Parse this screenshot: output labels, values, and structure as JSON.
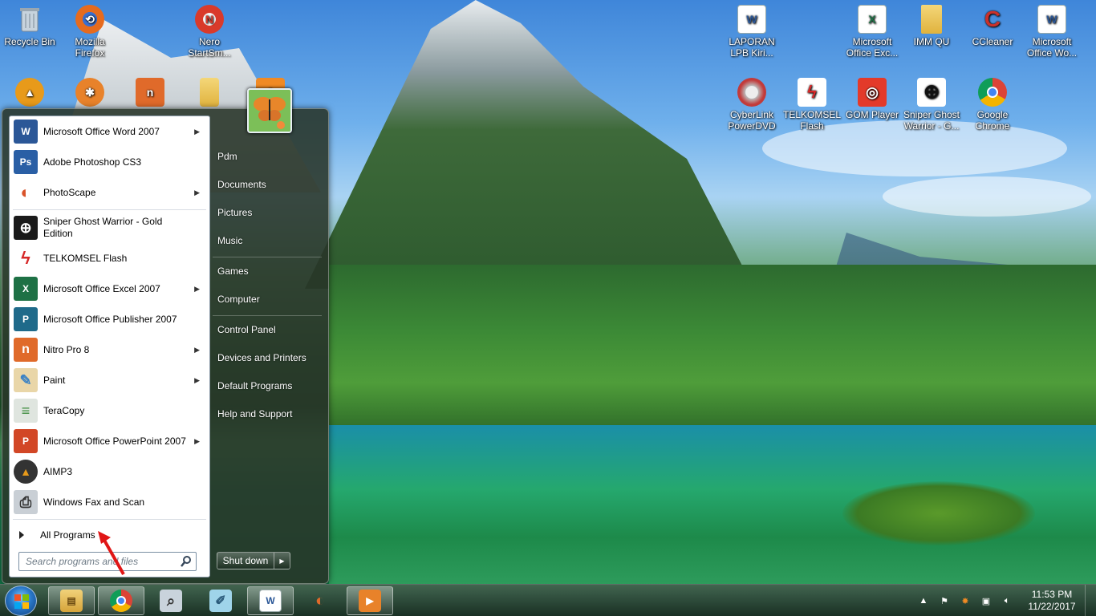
{
  "desktop": {
    "icons": [
      {
        "label": "Recycle Bin",
        "icon": "recycle-bin-icon",
        "color": "#a9b8c6"
      },
      {
        "label": "Mozilla Firefox",
        "icon": "firefox-icon",
        "color": "#e66b1e"
      },
      {
        "label": "Nero StartSm...",
        "icon": "nero-icon",
        "color": "#d93a2a"
      },
      {
        "label": "LAPORAN LPB Kiri...",
        "icon": "word-doc-icon",
        "color": "#2b5797"
      },
      {
        "label": "Microsoft Office Exc...",
        "icon": "excel-icon",
        "color": "#1e7145"
      },
      {
        "label": "IMM QU",
        "icon": "folder-icon",
        "color": "#e8c15a"
      },
      {
        "label": "CCleaner",
        "icon": "ccleaner-icon",
        "color": "#c8312b"
      },
      {
        "label": "Microsoft Office Wo...",
        "icon": "word-icon",
        "color": "#2b5797"
      },
      {
        "label": "CyberLink PowerDVD",
        "icon": "powerdvd-icon",
        "color": "#c23b3b"
      },
      {
        "label": "TELKOMSEL Flash",
        "icon": "telkomsel-icon",
        "color": "#d62828"
      },
      {
        "label": "GOM Player",
        "icon": "gom-player-icon",
        "color": "#e33a2a"
      },
      {
        "label": "Sniper Ghost Warrior - G...",
        "icon": "crosshair-icon",
        "color": "#222222"
      },
      {
        "label": "Google Chrome",
        "icon": "chrome-icon",
        "color": "#3a8f3a"
      }
    ],
    "partial_icons": [
      {
        "icon": "aimp-icon",
        "color": "#e89a1a"
      },
      {
        "icon": "ship-wheel-icon",
        "color": "#e8822a"
      },
      {
        "icon": "nitro-icon",
        "color": "#e06a2a"
      },
      {
        "icon": "folder-icon",
        "color": "#e8c15a"
      },
      {
        "icon": "photoscape-icon",
        "color": "#f08a24"
      }
    ]
  },
  "start_menu": {
    "programs": [
      {
        "label": "Microsoft Office Word 2007",
        "icon": "word-icon",
        "glyph": "W",
        "color": "#2b5797",
        "submenu": true
      },
      {
        "label": "Adobe Photoshop CS3",
        "icon": "photoshop-icon",
        "glyph": "Ps",
        "color": "#2a5fa5",
        "submenu": false
      },
      {
        "label": "PhotoScape",
        "icon": "photoscape-icon",
        "glyph": "◐",
        "color": "#6e7377",
        "submenu": true
      },
      {
        "label": "Sniper Ghost Warrior - Gold Edition",
        "icon": "crosshair-icon",
        "glyph": "⊕",
        "color": "#1a1a1a",
        "submenu": false
      },
      {
        "label": "TELKOMSEL Flash",
        "icon": "telkomsel-icon",
        "glyph": "ϟ",
        "color": "#d62828",
        "submenu": false
      },
      {
        "label": "Microsoft Office Excel 2007",
        "icon": "excel-icon",
        "glyph": "X",
        "color": "#1e7145",
        "submenu": true
      },
      {
        "label": "Microsoft Office Publisher 2007",
        "icon": "publisher-icon",
        "glyph": "P",
        "color": "#1f6a8a",
        "submenu": false
      },
      {
        "label": "Nitro Pro 8",
        "icon": "nitro-icon",
        "glyph": "n",
        "color": "#e06a2a",
        "submenu": true
      },
      {
        "label": "Paint",
        "icon": "paint-icon",
        "glyph": "✎",
        "color": "#3b82c4",
        "submenu": true
      },
      {
        "label": "TeraCopy",
        "icon": "teracopy-icon",
        "glyph": "≡",
        "color": "#6a8a6a",
        "submenu": false
      },
      {
        "label": "Microsoft Office PowerPoint 2007",
        "icon": "powerpoint-icon",
        "glyph": "P",
        "color": "#d24726",
        "submenu": true
      },
      {
        "label": "AIMP3",
        "icon": "aimp-icon",
        "glyph": "▲",
        "color": "#e89a1a",
        "submenu": false
      },
      {
        "label": "Windows Fax and Scan",
        "icon": "fax-scan-icon",
        "glyph": "⎙",
        "color": "#707a84",
        "submenu": false
      }
    ],
    "all_programs": "All Programs",
    "search_placeholder": "Search programs and files",
    "right_items": [
      {
        "label": "Pdm",
        "name": "user-folder-link"
      },
      {
        "label": "Documents",
        "name": "documents-link"
      },
      {
        "label": "Pictures",
        "name": "pictures-link"
      },
      {
        "label": "Music",
        "name": "music-link"
      },
      {
        "label": "Games",
        "name": "games-link"
      },
      {
        "label": "Computer",
        "name": "computer-link"
      },
      {
        "label": "Control Panel",
        "name": "control-panel-link"
      },
      {
        "label": "Devices and Printers",
        "name": "devices-printers-link"
      },
      {
        "label": "Default Programs",
        "name": "default-programs-link"
      },
      {
        "label": "Help and Support",
        "name": "help-support-link"
      }
    ],
    "shutdown_label": "Shut down"
  },
  "taskbar": {
    "apps": [
      {
        "icon": "windows-explorer-icon",
        "glyph": "▤",
        "color": "#e3b44a",
        "active": true
      },
      {
        "icon": "chrome-icon",
        "glyph": "◉",
        "color": "#3a8f3a",
        "active": true
      },
      {
        "icon": "scanner-search-icon",
        "glyph": "⌕",
        "color": "#8a98a8",
        "active": false
      },
      {
        "icon": "notepad-icon",
        "glyph": "✐",
        "color": "#58a6c6",
        "active": false
      },
      {
        "icon": "word-icon",
        "glyph": "W",
        "color": "#2b5797",
        "active": true
      },
      {
        "icon": "photoscape-icon",
        "glyph": "◐",
        "color": "#6e7377",
        "active": false
      },
      {
        "icon": "media-player-icon",
        "glyph": "▶",
        "color": "#e8822a",
        "active": true
      }
    ],
    "clock_time": "11:53 PM",
    "clock_date": "11/22/2017"
  }
}
